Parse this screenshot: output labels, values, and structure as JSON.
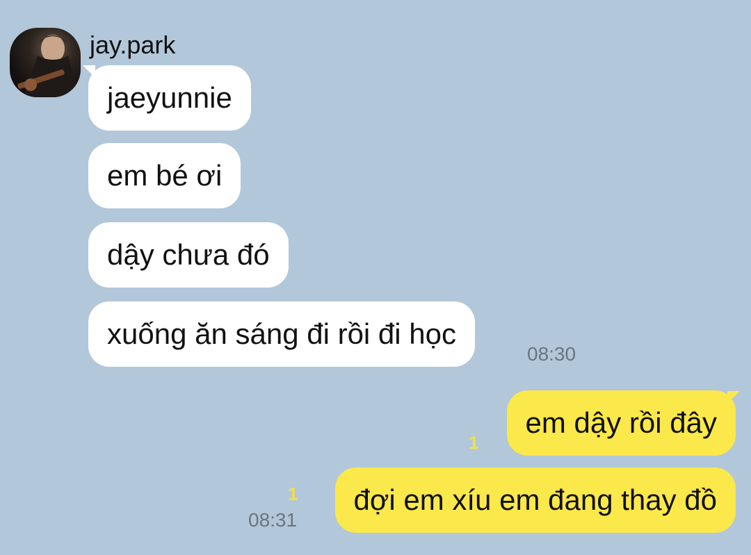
{
  "sender": {
    "name": "jay.park",
    "avatar_icon": "profile-photo-icon"
  },
  "incoming_messages": [
    {
      "text": "jaeyunnie"
    },
    {
      "text": "em bé ơi"
    },
    {
      "text": "dậy chưa đó"
    },
    {
      "text": "xuống ăn sáng đi rồi đi học"
    }
  ],
  "incoming_time": "08:30",
  "outgoing_messages": [
    {
      "text": "em dậy rồi đây",
      "unread": "1"
    },
    {
      "text": "đợi em xíu em đang thay đồ",
      "unread": "1"
    }
  ],
  "outgoing_time": "08:31",
  "colors": {
    "background": "#b2c7da",
    "incoming_bubble": "#ffffff",
    "outgoing_bubble": "#fbe84a",
    "unread": "#f2e04a",
    "time": "#6b7580"
  }
}
